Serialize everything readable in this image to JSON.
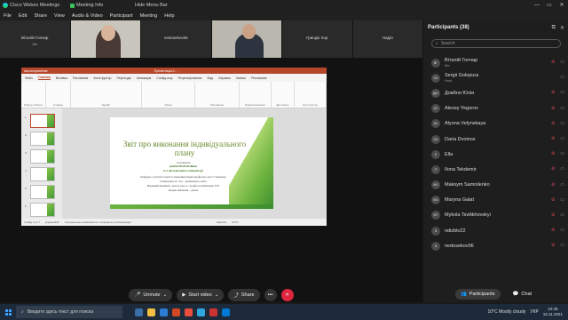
{
  "titlebar": {
    "app": "Cisco Webex Meetings",
    "meeting_info": "Meeting Info",
    "hide_menu": "Hide Menu Bar",
    "controls": [
      "—",
      "▭",
      "✕"
    ]
  },
  "menu": [
    "File",
    "Edit",
    "Share",
    "View",
    "Audio & Video",
    "Participant",
    "Meeting",
    "Help"
  ],
  "tiles": [
    {
      "name": "Віталій Гончар",
      "sub": "Me"
    },
    {
      "name": "",
      "sub": ""
    },
    {
      "name": "nedosekov06",
      "sub": ""
    },
    {
      "name": "",
      "sub": ""
    },
    {
      "name": "Гриндік Ігор",
      "sub": ""
    },
    {
      "name": "Надія",
      "sub": ""
    }
  ],
  "ppt": {
    "autosave": "Автосохранение",
    "doc_title": "Презентація 2...",
    "tabs": [
      "Файл",
      "Главная",
      "Вставка",
      "Рисование",
      "Конструктор",
      "Переходы",
      "Анимация",
      "Слайд-шоу",
      "Рецензирование",
      "Вид",
      "Справка",
      "Запись",
      "Рисование"
    ],
    "active_tab": "Главная",
    "ribbon_groups": [
      "Буфер обмена",
      "Слайды",
      "Шрифт",
      "Абзац",
      "Рисование",
      "Редактирование",
      "Диктовать",
      "Конструктор"
    ],
    "thumbs": [
      "1",
      "2",
      "3",
      "4",
      "5",
      "6"
    ],
    "slide": {
      "title": "Звіт про виконання індивідуального плану",
      "lines": [
        "І Аспіранта",
        "Довбні Юлії Юліївни",
        "за 2 рік навчання в аспірантурі",
        "Кафедра: сучасної теорії та практики науки професора А.О. Степанова",
        "Спеціальність: 012 – Дошкільна освіта",
        "Науковий керівник: доктор пед. н., професор Шевченко Т.В.",
        "Форма навчання – денна"
      ]
    },
    "status": [
      "Слайд 1 из 7",
      "украинский",
      "Специальные возможности: проверьте рекомендации",
      "Заметки",
      "64 %"
    ]
  },
  "controls": {
    "unmute": "Unmute",
    "video": "Start video",
    "share": "Share",
    "more": "•••",
    "end": "✕"
  },
  "panel": {
    "title": "Participants (38)",
    "search_placeholder": "Search",
    "participants": [
      {
        "initials": "ВГ",
        "name": "Віталій Гончар",
        "role": "Me",
        "mic": true
      },
      {
        "initials": "SG",
        "name": "Sergii Golopura",
        "role": "Host",
        "mic": false
      },
      {
        "initials": "ДЮ",
        "name": "Довбня Юлія",
        "role": "",
        "mic": true
      },
      {
        "initials": "AY",
        "name": "Alexey Yegorov",
        "role": "",
        "mic": true
      },
      {
        "initials": "AV",
        "name": "Alyona Velynskaya",
        "role": "",
        "mic": true
      },
      {
        "initials": "DD",
        "name": "Daria Dvoinos",
        "role": "",
        "mic": true
      },
      {
        "initials": "E",
        "name": "Ella",
        "role": "",
        "mic": true
      },
      {
        "initials": "IT",
        "name": "Ilona Tekdemir",
        "role": "",
        "mic": true
      },
      {
        "initials": "MS",
        "name": "Maksym Samoilenko",
        "role": "",
        "mic": true
      },
      {
        "initials": "MG",
        "name": "Maryna Galat",
        "role": "",
        "mic": true
      },
      {
        "initials": "MT",
        "name": "Mykola Tsvilikhovskyi",
        "role": "",
        "mic": true
      },
      {
        "initials": "N",
        "name": "ndizbtv22",
        "role": "",
        "mic": true
      },
      {
        "initials": "N",
        "name": "nedosekov06",
        "role": "",
        "mic": true
      }
    ],
    "participants_btn": "Participants",
    "chat_btn": "Chat"
  },
  "taskbar": {
    "search": "Введите здесь текст для поиска",
    "weather": "10°C  Mostly cloudy",
    "lang": "УКР",
    "time": "10:45",
    "date": "16.11.2021"
  },
  "colors": {
    "ppt_accent": "#b7472a",
    "slide_green": "#6db33f",
    "end_red": "#e0263e",
    "mic_muted": "#e74c5a"
  }
}
